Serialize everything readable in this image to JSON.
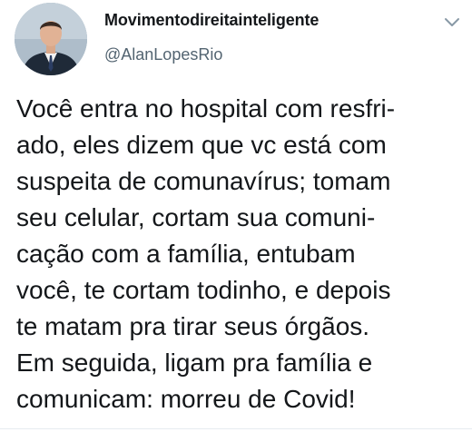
{
  "tweet": {
    "display_name": "Movimentodireitainteligente",
    "handle": "@AlanLopesRio",
    "menu_icon": "chevron-down-icon",
    "avatar_icon": "user-avatar",
    "text_lines": [
      "Você entra no hospital com resfri-",
      "ado, eles dizem que vc está com",
      "suspeita de comunavírus; tomam",
      "seu celular, cortam sua comuni-",
      "cação com a família, entubam",
      "você, te cortam todinho, e depois",
      "te matam pra tirar seus órgãos.",
      "Em seguida, ligam pra família e",
      "comunicam: morreu de Covid!"
    ]
  },
  "colors": {
    "text": "#14171a",
    "secondary_text": "#536471",
    "divider": "#e6ecf0"
  }
}
